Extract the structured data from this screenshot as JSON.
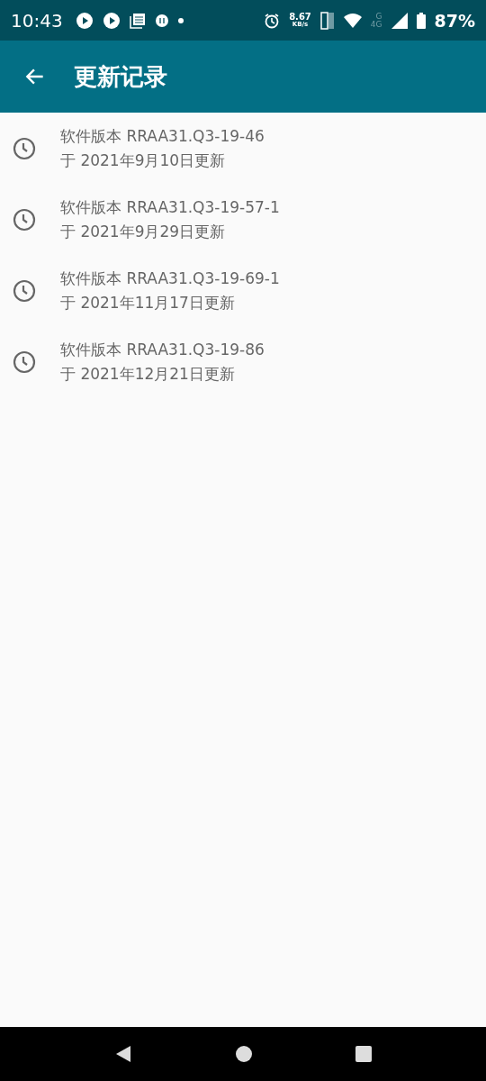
{
  "status_bar": {
    "time": "10:43",
    "net_speed": "8.67",
    "net_unit": "KB/s",
    "network_top": "G",
    "network_bottom": "4G",
    "battery": "87%"
  },
  "app_bar": {
    "title": "更新记录"
  },
  "updates": [
    {
      "version": "软件版本 RRAA31.Q3-19-46",
      "date": "于 2021年9月10日更新"
    },
    {
      "version": "软件版本 RRAA31.Q3-19-57-1",
      "date": "于 2021年9月29日更新"
    },
    {
      "version": "软件版本 RRAA31.Q3-19-69-1",
      "date": "于 2021年11月17日更新"
    },
    {
      "version": "软件版本 RRAA31.Q3-19-86",
      "date": "于 2021年12月21日更新"
    }
  ]
}
